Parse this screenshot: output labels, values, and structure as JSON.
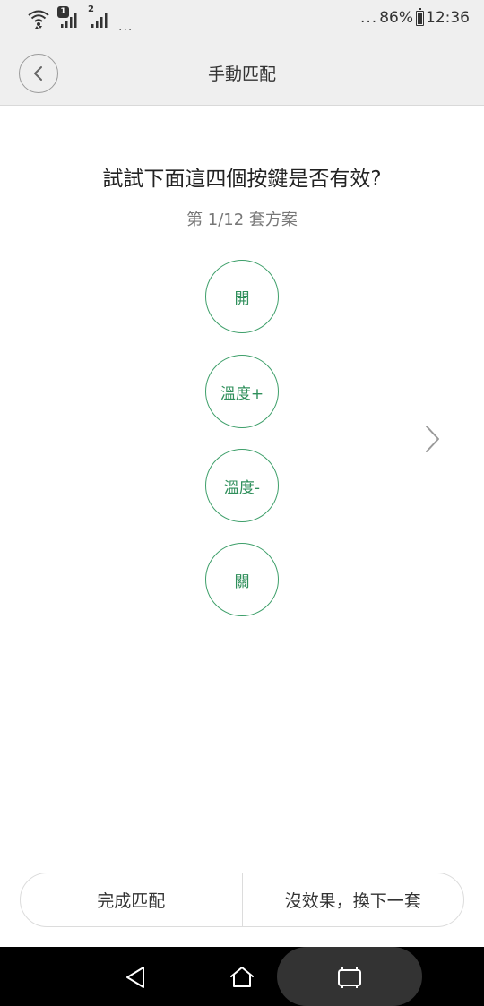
{
  "status_bar": {
    "sim1_badge": "1",
    "sim2_label": "2",
    "left_dots": "...",
    "right_dots": "...",
    "battery": "86%",
    "battery_level": 0.86,
    "time": "12:36"
  },
  "header": {
    "title": "手動匹配",
    "back_icon": "chevron-left-icon"
  },
  "main": {
    "question": "試試下面這四個按鍵是否有效?",
    "scheme": "第 1/12 套方案",
    "keys": [
      "開",
      "溫度+",
      "溫度-",
      "關"
    ],
    "next_icon": "chevron-right-icon",
    "accent_color": "#3e9f6a"
  },
  "bottom": {
    "done_label": "完成匹配",
    "next_set_label": "沒效果，換下一套"
  },
  "nav_bar": {
    "back_icon": "triangle-back-icon",
    "home_icon": "home-icon",
    "recents_icon": "recents-icon"
  }
}
